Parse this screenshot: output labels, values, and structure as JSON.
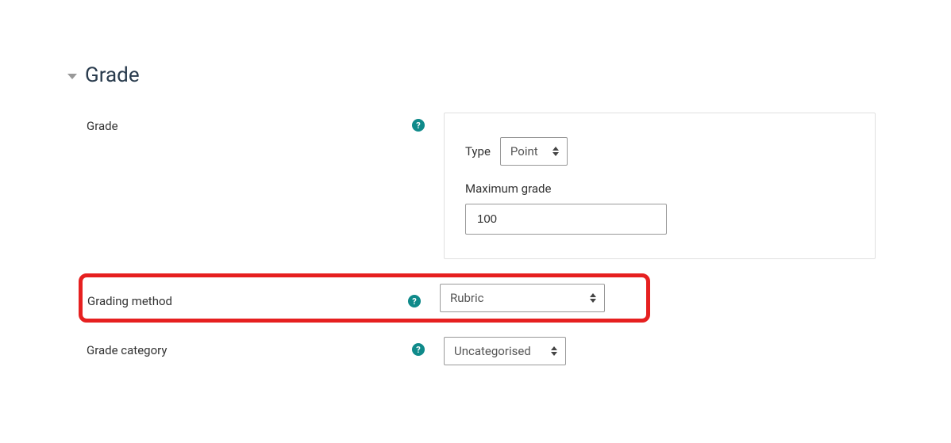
{
  "section": {
    "title": "Grade"
  },
  "grade": {
    "label": "Grade",
    "type_label": "Type",
    "type_value": "Point",
    "max_label": "Maximum grade",
    "max_value": "100"
  },
  "grading_method": {
    "label": "Grading method",
    "value": "Rubric"
  },
  "grade_category": {
    "label": "Grade category",
    "value": "Uncategorised"
  },
  "help_icon_text": "?"
}
